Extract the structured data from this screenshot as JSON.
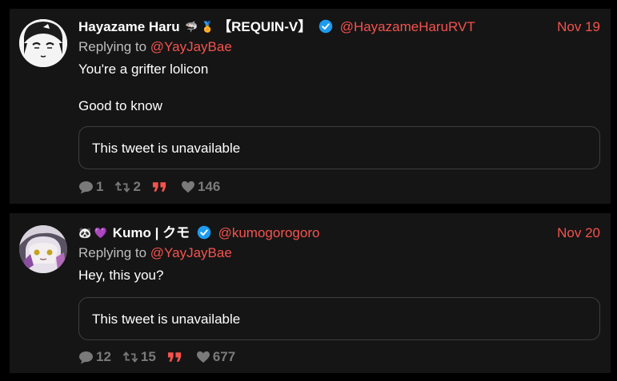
{
  "tweets": [
    {
      "display_name": "Hayazame Haru",
      "name_emojis_before": "",
      "name_emojis_after": "🦈 🏅",
      "name_suffix": "【REQUIN-V】",
      "handle": "@HayazameHaruRVT",
      "date": "Nov 19",
      "replying_prefix": "Replying to",
      "replying_handle": "@YayJayBae",
      "paragraphs": [
        "You're a grifter lolicon",
        "Good to know"
      ],
      "quoted_text": "This tweet is unavailable",
      "replies": "1",
      "retweets": "2",
      "likes": "146"
    },
    {
      "display_name": "Kumo | クモ",
      "name_emojis_before": "🐼 💜",
      "name_emojis_after": "",
      "name_suffix": "",
      "handle": "@kumogorogoro",
      "date": "Nov 20",
      "replying_prefix": "Replying to",
      "replying_handle": "@YayJayBae",
      "paragraphs": [
        "Hey, this you?"
      ],
      "quoted_text": "This tweet is unavailable",
      "replies": "12",
      "retweets": "15",
      "likes": "677"
    }
  ],
  "colors": {
    "accent": "#f5524d",
    "verified": "#1d9bf0",
    "card_bg": "#151515",
    "page_bg": "#000000",
    "muted": "#7a7a7a"
  },
  "icons": {
    "reply": "speech-bubble-icon",
    "retweet": "retweet-icon",
    "quote": "quote-marks-icon",
    "like": "heart-icon",
    "verified": "verified-badge-icon"
  }
}
